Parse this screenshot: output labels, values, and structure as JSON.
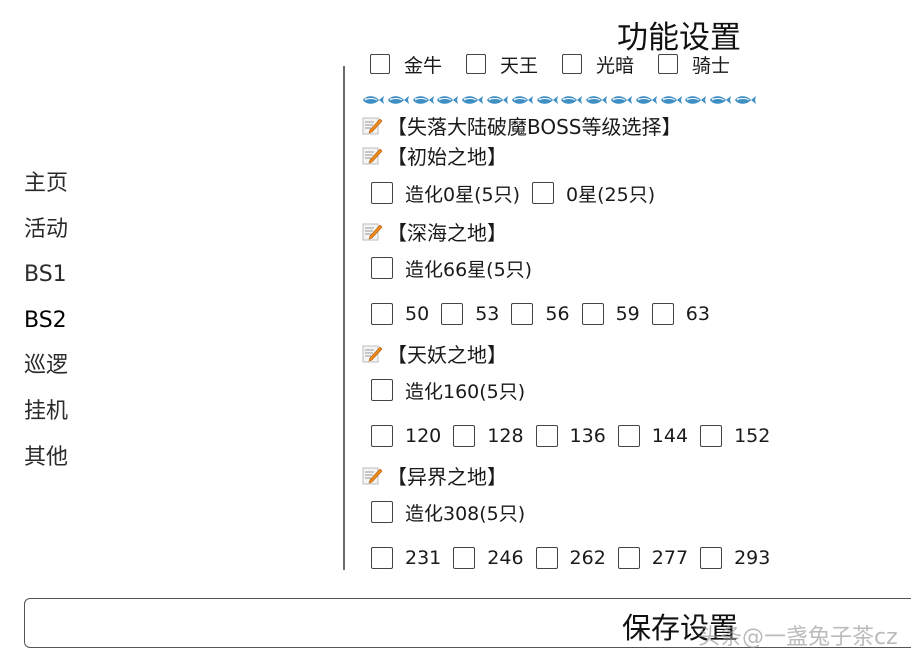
{
  "header": {
    "title": "功能设置"
  },
  "sidebar": {
    "items": [
      "主页",
      "活动",
      "BS1",
      "BS2",
      "巡逻",
      "挂机",
      "其他"
    ],
    "active": "BS2"
  },
  "top_partial_row": {
    "items": [
      "金牛",
      "天王",
      "光暗",
      "骑士"
    ]
  },
  "divider_icon": "fish-icon",
  "divider_count": 16,
  "heading": "【失落大陆破魔BOSS等级选择】",
  "zones": [
    {
      "title": "【初始之地】",
      "rows": [
        [
          "造化0星(5只)",
          "0星(25只)"
        ]
      ]
    },
    {
      "title": "【深海之地】",
      "rows": [
        [
          "造化66星(5只)"
        ],
        [
          "50",
          "53",
          "56",
          "59",
          "63"
        ]
      ]
    },
    {
      "title": "【天妖之地】",
      "rows": [
        [
          "造化160(5只)"
        ],
        [
          "120",
          "128",
          "136",
          "144",
          "152"
        ]
      ]
    },
    {
      "title": "【异界之地】",
      "rows": [
        [
          "造化308(5只)"
        ],
        [
          "231",
          "246",
          "262",
          "277",
          "293"
        ]
      ]
    }
  ],
  "footer": {
    "save_label": "保存设置"
  },
  "watermark": "头条@一盏兔子茶cz",
  "colors": {
    "fish": "#3f8fc4",
    "memo_pencil": "#f08a1c"
  }
}
